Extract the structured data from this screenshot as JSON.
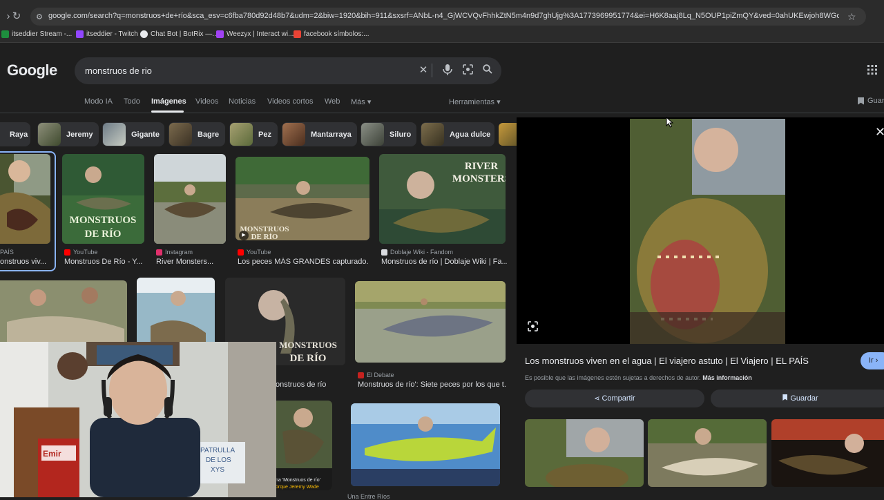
{
  "browser": {
    "url": "google.com/search?q=monstruos+de+río&sca_esv=c6fba780d92d48b7&udm=2&biw=1920&bih=911&sxsrf=ANbL-n4_GjWCVQvFhhkZtN5m4n9d7ghUjg%3A1773969951774&ei=H6K8aaj8Lq_N5OUP1piZmQY&ved=0ahUKEwjoh8WGqa2TAxWvJrkGHVZMJ...",
    "bookmarks": [
      {
        "label": "itseddier Stream -...",
        "color": "#1e8e3e"
      },
      {
        "label": "itseddier - Twitch",
        "color": "#9146ff"
      },
      {
        "label": "Chat Bot | BotRix —...",
        "color": "#e8eaed"
      },
      {
        "label": "Weezyx | Interact wi...",
        "color": "#a142f4"
      },
      {
        "label": "facebook símbolos:...",
        "color": "#ea4335"
      }
    ]
  },
  "google": {
    "logo": "Google",
    "query": "monstruos de rio",
    "tabs": [
      "Modo IA",
      "Todo",
      "Imágenes",
      "Videos",
      "Noticias",
      "Videos cortos",
      "Web",
      "Más ▾"
    ],
    "tools": "Herramientas ▾",
    "save_partial": "Guar"
  },
  "chips": [
    "Raya",
    "Jeremy",
    "Gigante",
    "Bagre",
    "Pez",
    "Mantarraya",
    "Siluro",
    "Agua dulce"
  ],
  "results": {
    "row1": [
      {
        "source": "PAÍS",
        "title": "onstruos viv..."
      },
      {
        "source": "YouTube",
        "title": "Monstruos De Río - Y..."
      },
      {
        "source": "Instagram",
        "title": "River Monsters..."
      },
      {
        "source": "YouTube",
        "title": "Los peces MÁS GRANDES capturado..."
      },
      {
        "source": "Doblaje Wiki - Fandom",
        "title": "Monstruos de río | Doblaje Wiki | Fa..."
      }
    ],
    "row2": [
      {
        "source": "",
        "title": "onstruos de río"
      },
      {
        "source": "El Debate",
        "title": "Monstruos de río': Siete peces por los que t..."
      }
    ],
    "row3_source": "Una Entre Ríos",
    "caption_overlay_1": "na 'Monstruos de río'",
    "caption_overlay_2": "orque Jeremy Wade",
    "thumb_texts": {
      "monstruos": "MONSTRUOS",
      "derio": "DE RÍO",
      "river": "RIVER",
      "monsters": "MONSTERS"
    }
  },
  "preview": {
    "title": "Los monstruos viven en el agua | El viajero astuto | El Viajero | EL PAÍS",
    "copyright": "Es posible que las imágenes estén sujetas a derechos de autor.",
    "more_info": "Más información",
    "visit": "Ir ›",
    "share": "Compartir",
    "save": "Guardar"
  },
  "webcam": {
    "sign_line1": "PATRULLA",
    "sign_line2": "DE LOS",
    "sign_line3": "XYS",
    "shirt": "Emir"
  }
}
